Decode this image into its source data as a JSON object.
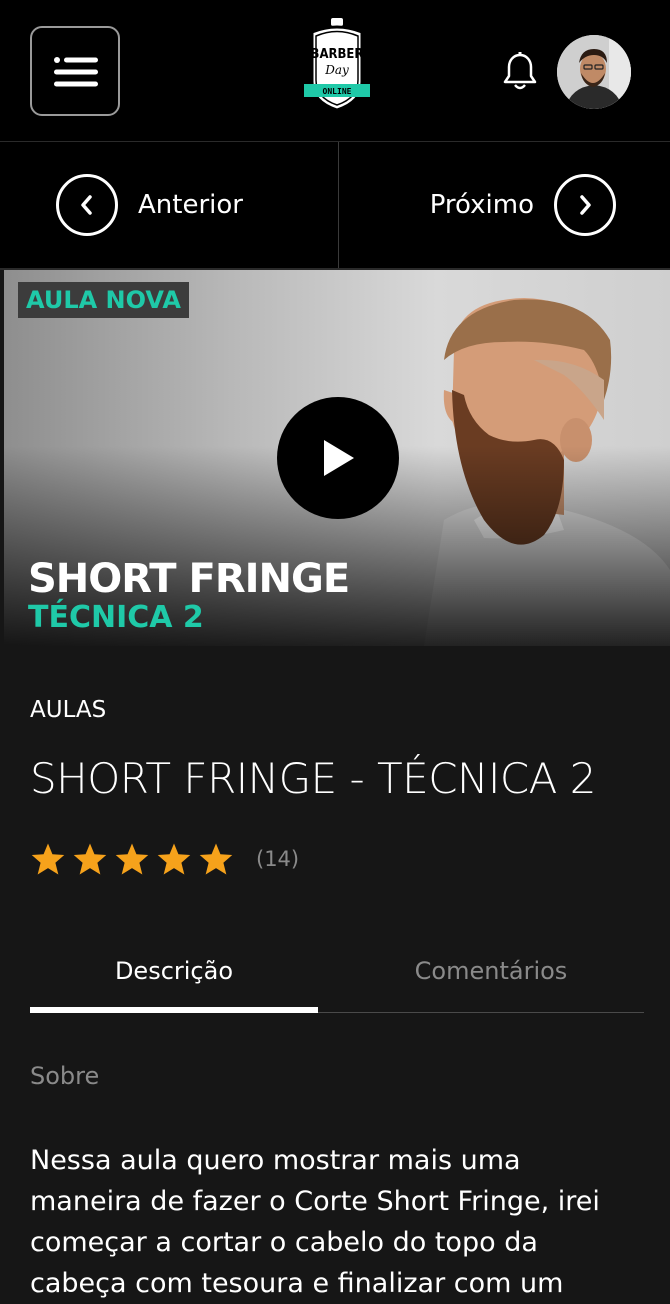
{
  "header": {
    "logo": {
      "line1": "BARBER",
      "line2": "Day",
      "line3": "ONLINE"
    },
    "accent_color": "#1fc9a8"
  },
  "navigation": {
    "prev_label": "Anterior",
    "next_label": "Próximo"
  },
  "video": {
    "badge": "AULA NOVA",
    "title": "SHORT FRINGE",
    "subtitle": "TÉCNICA 2"
  },
  "lesson": {
    "category": "AULAS",
    "title": "SHORT FRINGE - TÉCNICA 2",
    "rating": {
      "stars": 5,
      "max": 5,
      "count_label": "(14)"
    }
  },
  "tabs": [
    {
      "label": "Descrição",
      "active": true
    },
    {
      "label": "Comentários",
      "active": false
    }
  ],
  "content": {
    "section_label": "Sobre",
    "description": "Nessa aula quero mostrar mais uma maneira de fazer o Corte Short Fringe, irei começar a cortar o cabelo do topo da cabeça com tesoura e finalizar com um"
  }
}
